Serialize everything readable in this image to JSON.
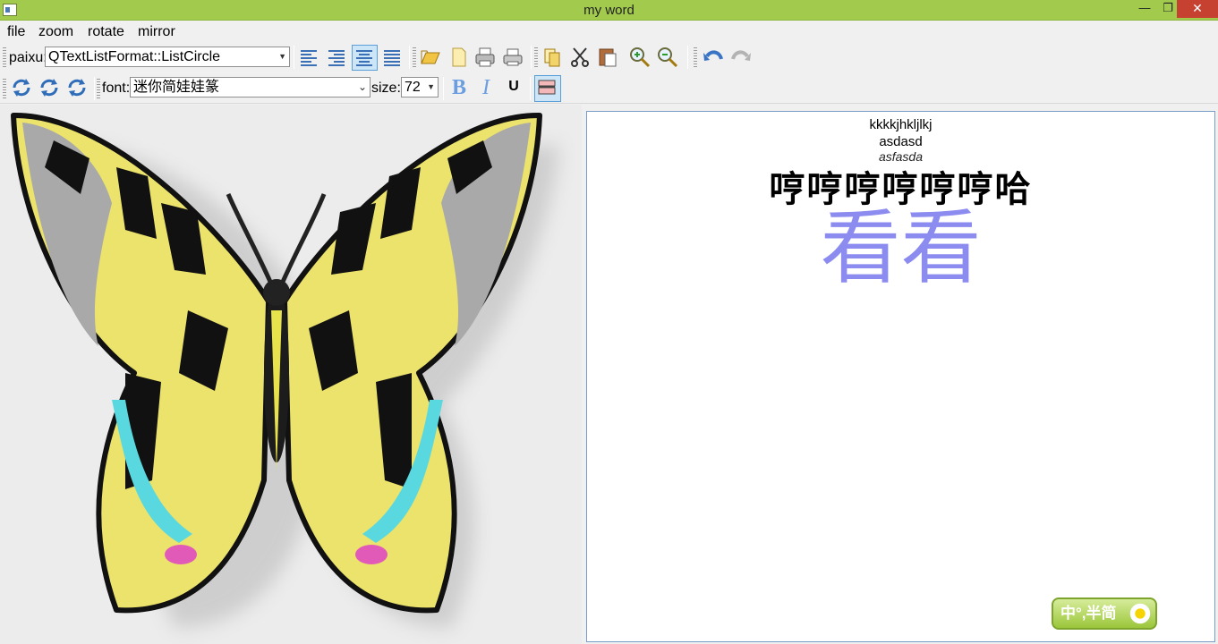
{
  "window": {
    "title": "my word"
  },
  "menu": {
    "items": [
      "file",
      "zoom",
      "rotate",
      "mirror"
    ]
  },
  "toolbar1": {
    "paixu_label": "paixu:",
    "list_style_value": "QTextListFormat::ListCircle"
  },
  "toolbar2": {
    "font_label": "font:",
    "font_value": "迷你简娃娃篆",
    "size_label": "size:",
    "size_value": "72",
    "bold_label": "B",
    "italic_label": "I",
    "underline_label": "U"
  },
  "editor": {
    "lines": [
      "kkkkjhkljlkj",
      "asdasd",
      "asfasda",
      "哼哼哼哼哼哼哈",
      "看看"
    ]
  },
  "ime": {
    "text": "中°,半简"
  },
  "colors": {
    "titlebar": "#a2cb4e",
    "big_text": "#8c8cf0",
    "editor_border": "#7a9cc8"
  },
  "icons": [
    "align-left-icon",
    "align-right-icon",
    "align-center-icon",
    "align-justify-icon",
    "open-icon",
    "new-icon",
    "print-preview-icon",
    "print-icon",
    "copy-icon",
    "cut-icon",
    "paste-icon",
    "zoom-in-icon",
    "zoom-out-icon",
    "undo-icon",
    "redo-icon",
    "rotate-90-icon",
    "rotate-180-icon",
    "rotate-270-icon",
    "color-icon"
  ]
}
